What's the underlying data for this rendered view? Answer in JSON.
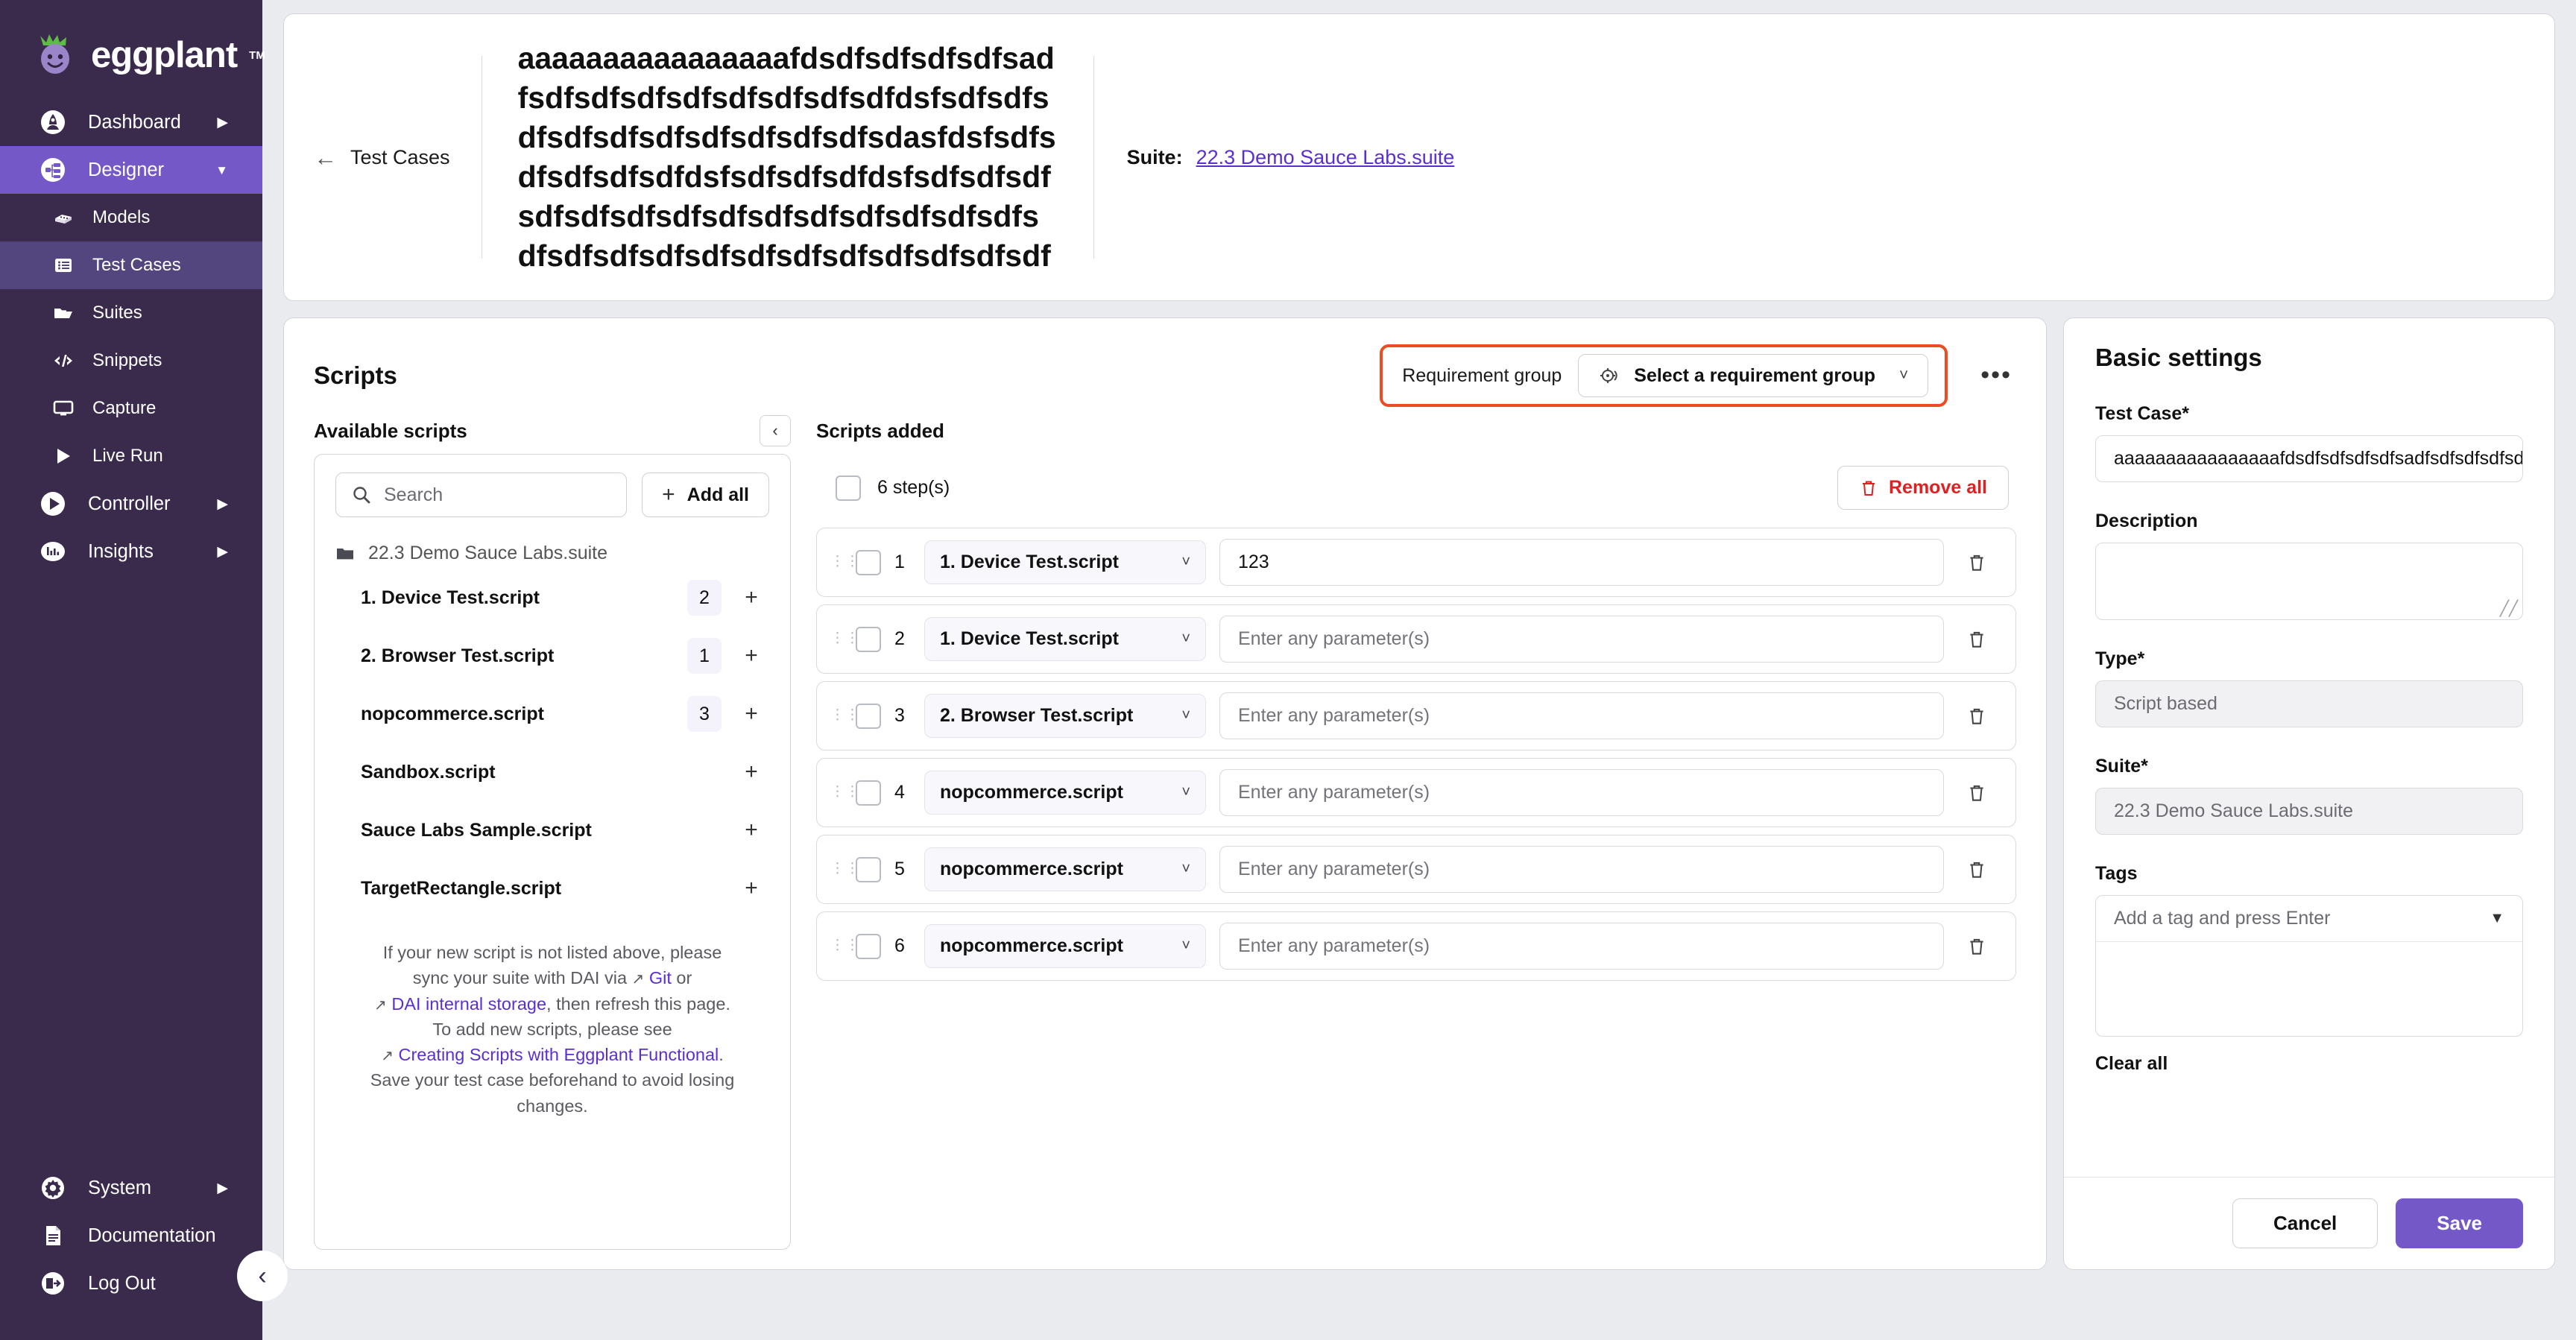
{
  "brand": {
    "name": "eggplant",
    "tm": "TM",
    "logo_icon": "eggplant-mascot-icon"
  },
  "colors": {
    "sidebar_bg": "#3a2b4d",
    "accent_primary": "#7458c8",
    "accent_sub": "#53467f",
    "link": "#5b2ed1",
    "danger": "#e02020",
    "highlight_outline": "#ec4c22"
  },
  "sidebar": {
    "items": [
      {
        "label": "Dashboard",
        "icon": "rocket-icon",
        "caret": "▶",
        "state": "normal",
        "level": 1
      },
      {
        "label": "Designer",
        "icon": "designer-nodes-icon",
        "caret": "▼",
        "state": "active-primary",
        "level": 1
      },
      {
        "label": "Models",
        "icon": "blocks-icon",
        "caret": "",
        "state": "normal",
        "level": 2
      },
      {
        "label": "Test Cases",
        "icon": "list-icon",
        "caret": "",
        "state": "active-sub",
        "level": 2
      },
      {
        "label": "Suites",
        "icon": "folder-icon",
        "caret": "",
        "state": "normal",
        "level": 2
      },
      {
        "label": "Snippets",
        "icon": "code-icon",
        "caret": "",
        "state": "normal",
        "level": 2
      },
      {
        "label": "Capture",
        "icon": "monitor-icon",
        "caret": "",
        "state": "normal",
        "level": 2
      },
      {
        "label": "Live Run",
        "icon": "play-icon",
        "caret": "",
        "state": "normal",
        "level": 2
      },
      {
        "label": "Controller",
        "icon": "play-circle-icon",
        "caret": "▶",
        "state": "normal",
        "level": 1
      },
      {
        "label": "Insights",
        "icon": "bar-chart-icon",
        "caret": "▶",
        "state": "normal",
        "level": 1
      }
    ],
    "bottom_items": [
      {
        "label": "System",
        "icon": "gear-icon",
        "caret": "▶"
      },
      {
        "label": "Documentation",
        "icon": "document-icon",
        "caret": ""
      },
      {
        "label": "Log Out",
        "icon": "logout-icon",
        "caret": ""
      }
    ],
    "collapse_icon": "chevron-left-icon"
  },
  "header": {
    "back_label": "Test Cases",
    "back_icon": "arrow-left-icon",
    "test_case_title": "aaaaaaaaaaaaaaaafdsdfsdfsdfsdfsadfsdfsdfsdfsdfsdfsdfsdfsdfdsfsdfsdfsdfsdfsdfsdfsdfsdfsdfsdfsdasfdsfsdfsdfsdfsdfsdfdsfsdfsdfsdfdsfsdfsdfsdfsdfsdfsdfsdfsdfsdfsdfsdfsdfsdfsdfsdfsdfsdfsdfsdfsdfsdfsdfsdfsdfsdfsdf",
    "suite_label": "Suite:",
    "suite_link": "22.3 Demo Sauce Labs.suite"
  },
  "scripts_panel": {
    "title": "Scripts",
    "requirement_group_label": "Requirement group",
    "requirement_group_value": "Select a requirement group",
    "requirement_group_icon": "target-icon",
    "chevron_icon": "chevron-down-icon",
    "kebab_label": "•••"
  },
  "available": {
    "title": "Available scripts",
    "collapse_icon": "chevron-left-icon",
    "search_placeholder": "Search",
    "search_icon": "search-icon",
    "add_all_label": "Add all",
    "suite_folder": "22.3 Demo Sauce Labs.suite",
    "folder_icon": "folder-icon",
    "scripts": [
      {
        "name": "1. Device Test.script",
        "count": "2"
      },
      {
        "name": "2. Browser Test.script",
        "count": "1"
      },
      {
        "name": "nopcommerce.script",
        "count": "3"
      },
      {
        "name": "Sandbox.script",
        "count": ""
      },
      {
        "name": "Sauce Labs Sample.script",
        "count": ""
      },
      {
        "name": "TargetRectangle.script",
        "count": ""
      }
    ],
    "help": {
      "line1": "If your new script is not listed above, please",
      "line2a": "sync your suite with DAI via",
      "link_git": "Git",
      "line2b": "or",
      "link_dai": "DAI internal storage",
      "line3": ", then refresh this page.",
      "line4": "To add new scripts, please see",
      "link_creating": "Creating Scripts with Eggplant Functional",
      "line5": ".",
      "line6": "Save your test case beforehand to avoid losing changes."
    }
  },
  "added": {
    "title": "Scripts added",
    "steps_count_label": "6 step(s)",
    "remove_all_label": "Remove all",
    "trash_icon": "trash-icon",
    "param_placeholder": "Enter any parameter(s)",
    "steps": [
      {
        "num": "1",
        "script": "1. Device Test.script",
        "param": "123"
      },
      {
        "num": "2",
        "script": "1. Device Test.script",
        "param": ""
      },
      {
        "num": "3",
        "script": "2. Browser Test.script",
        "param": ""
      },
      {
        "num": "4",
        "script": "nopcommerce.script",
        "param": ""
      },
      {
        "num": "5",
        "script": "nopcommerce.script",
        "param": ""
      },
      {
        "num": "6",
        "script": "nopcommerce.script",
        "param": ""
      }
    ]
  },
  "settings": {
    "title": "Basic settings",
    "test_case_label": "Test Case*",
    "test_case_value": "aaaaaaaaaaaaaaaafdsdfsdfsdfsdfsadfsdfsdfsdfsdf",
    "description_label": "Description",
    "description_value": "",
    "type_label": "Type*",
    "type_value": "Script based",
    "suite_label": "Suite*",
    "suite_value": "22.3 Demo Sauce Labs.suite",
    "tags_label": "Tags",
    "tags_placeholder": "Add a tag and press Enter",
    "tags_arrow_icon": "triangle-down-icon",
    "clear_all_label": "Clear all",
    "cancel_label": "Cancel",
    "save_label": "Save"
  }
}
